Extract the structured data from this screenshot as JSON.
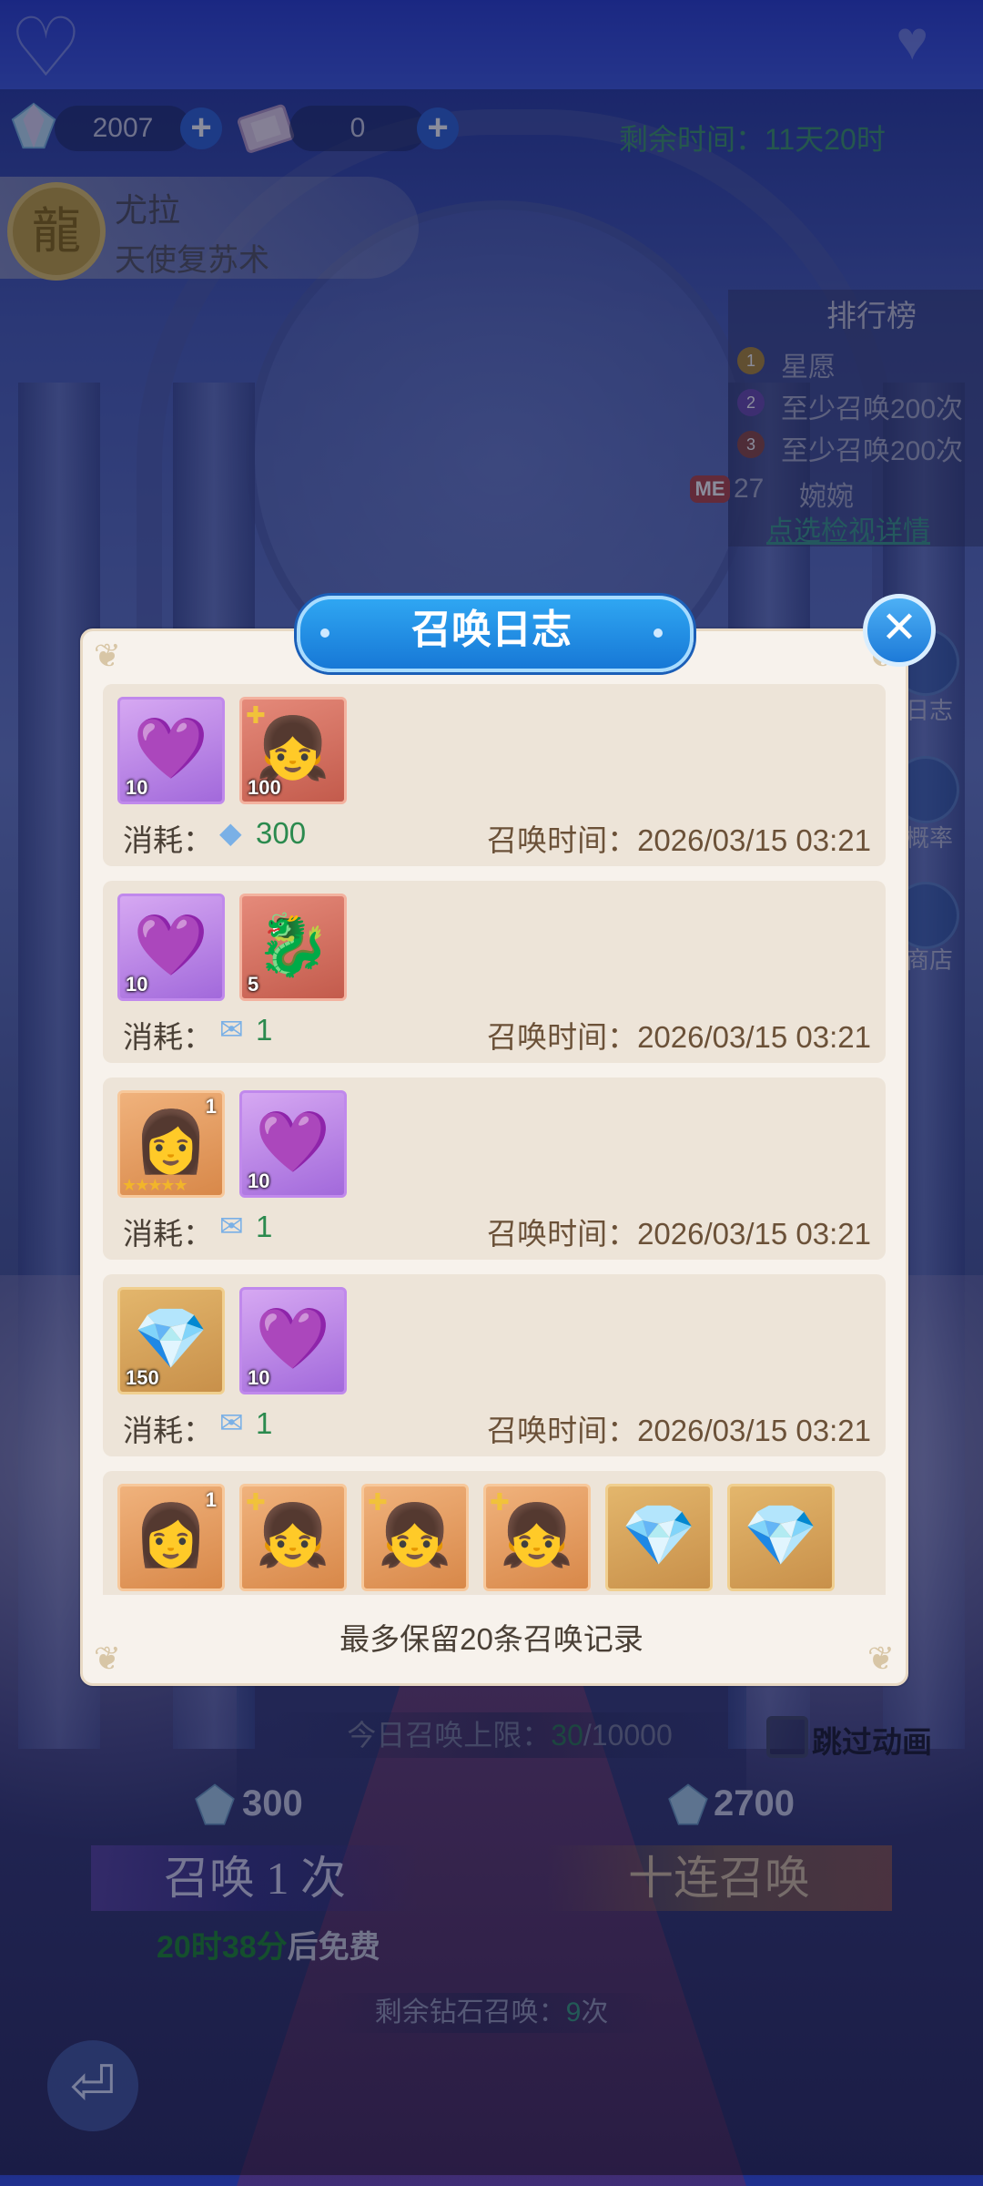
{
  "header": {
    "diamond_amount": "2007",
    "ticket_amount": "0",
    "remaining_time": "剩余时间：11天20时"
  },
  "hero": {
    "name": "尤拉",
    "skill": "天使复苏术"
  },
  "ranking": {
    "title": "排行榜",
    "rows": [
      {
        "rank": "1",
        "text": "星愿",
        "color": "#c89a3a"
      },
      {
        "rank": "2",
        "text": "至少召唤200次",
        "color": "#8a5cc8"
      },
      {
        "rank": "3",
        "text": "至少召唤200次",
        "color": "#b0584a"
      }
    ],
    "me_badge": "ME",
    "me_rank": "27",
    "me_name": "婉婉",
    "detail_link": "点选检视详情"
  },
  "side_menu": {
    "log": "日志",
    "rate": "概率",
    "shop": "商店"
  },
  "modal": {
    "title": "召唤日志",
    "close_icon": "close-icon",
    "cost_label": "消耗：",
    "time_label": "召唤时间：",
    "records": [
      {
        "items": [
          {
            "icon": "heart-crystal-icon",
            "style": "purple",
            "count": "10"
          },
          {
            "icon": "character-fragment-icon",
            "style": "red",
            "count": "100",
            "puzzle": true
          }
        ],
        "cost_icon": "diamond-icon",
        "cost": "300",
        "time": "2026/03/15 03:21"
      },
      {
        "items": [
          {
            "icon": "heart-crystal-icon",
            "style": "purple",
            "count": "10"
          },
          {
            "icon": "dragon-emblem-icon",
            "style": "red",
            "count": "5"
          }
        ],
        "cost_icon": "ticket-icon",
        "cost": "1",
        "time": "2026/03/15 03:21"
      },
      {
        "items": [
          {
            "icon": "character-portrait-icon",
            "style": "orange",
            "count": "1",
            "stars": "★★★★★"
          },
          {
            "icon": "heart-crystal-icon",
            "style": "purple",
            "count": "10"
          }
        ],
        "cost_icon": "ticket-icon",
        "cost": "1",
        "time": "2026/03/15 03:21"
      },
      {
        "items": [
          {
            "icon": "diamond-pile-icon",
            "style": "gold",
            "count": "150"
          },
          {
            "icon": "heart-crystal-icon",
            "style": "purple",
            "count": "10"
          }
        ],
        "cost_icon": "ticket-icon",
        "cost": "1",
        "time": "2026/03/15 03:21"
      }
    ],
    "partial_row_items": [
      {
        "icon": "character-portrait-icon",
        "style": "orange",
        "count": "1"
      },
      {
        "icon": "character-fragment-icon",
        "style": "orange",
        "puzzle": true
      },
      {
        "icon": "character-fragment-icon",
        "style": "orange",
        "puzzle": true
      },
      {
        "icon": "character-fragment-icon",
        "style": "orange",
        "puzzle": true
      },
      {
        "icon": "diamond-pile-icon",
        "style": "gold"
      },
      {
        "icon": "diamond-pile-icon",
        "style": "gold"
      }
    ],
    "footer_note": "最多保留20条召唤记录"
  },
  "bottom": {
    "limit_prefix": "今日召唤上限：",
    "limit_used": "30",
    "limit_total": "/10000",
    "skip_label": "跳过动画",
    "single_cost": "300",
    "ten_cost": "2700",
    "single_label": "召唤 1 次",
    "ten_label": "十连召唤",
    "free_time": "20时38分",
    "free_suffix": "后免费",
    "remain_prefix": "剩余钻石召唤：",
    "remain_count": "9",
    "remain_suffix": "次"
  },
  "colors": {
    "accent_blue": "#1778d6",
    "cost_green": "#2b8a4e",
    "time_brown": "#6b5138"
  }
}
